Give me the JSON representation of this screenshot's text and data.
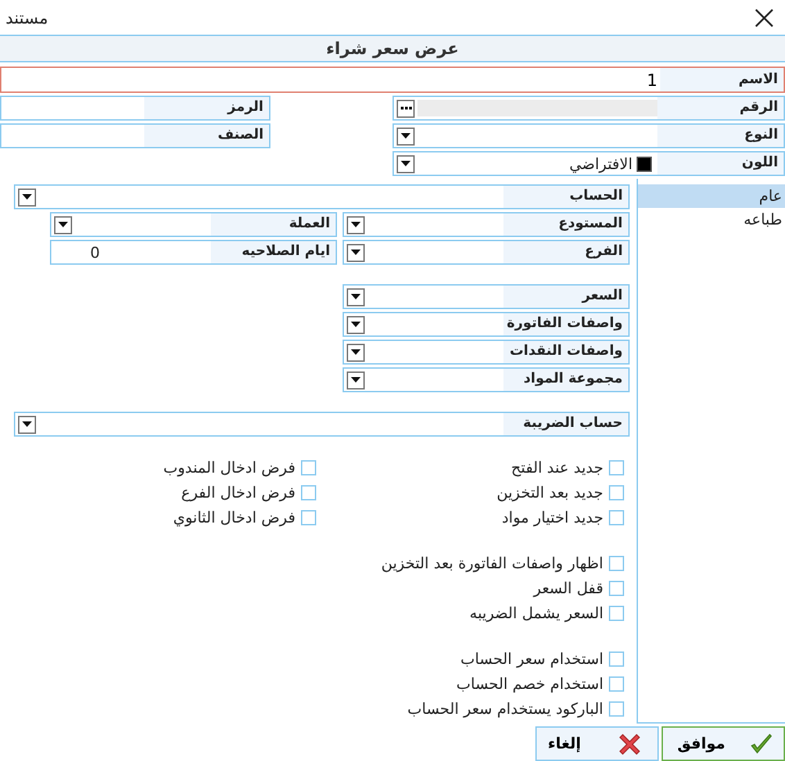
{
  "window": {
    "title": "مستند"
  },
  "header": "عرض سعر شراء",
  "name_field": {
    "label": "الاسم",
    "value": "1"
  },
  "top_right_fields": [
    {
      "label": "الرقم",
      "kind": "browse"
    },
    {
      "label": "النوع",
      "kind": "dropdown"
    },
    {
      "label": "اللون",
      "kind": "color",
      "color": "#000000",
      "value": "الافتراضي"
    }
  ],
  "top_left_fields": [
    {
      "label": "الرمز",
      "kind": "text"
    },
    {
      "label": "الصنف",
      "kind": "text"
    }
  ],
  "sidebar": {
    "items": [
      {
        "label": "عام",
        "selected": true
      },
      {
        "label": "طباعه",
        "selected": false
      }
    ]
  },
  "field_groups": [
    [
      {
        "kind": "wide",
        "fields": [
          {
            "label": "الحساب",
            "kind": "dropdown"
          }
        ]
      },
      {
        "kind": "pair",
        "fields": [
          {
            "label": "المستودع",
            "kind": "dropdown"
          },
          {
            "label": "العملة",
            "kind": "dropdown"
          }
        ]
      },
      {
        "kind": "pair",
        "fields": [
          {
            "label": "الفرع",
            "kind": "dropdown"
          },
          {
            "label": "ايام الصلاحيه",
            "kind": "text",
            "value": "0"
          }
        ]
      }
    ],
    [
      {
        "kind": "pair",
        "fields": [
          {
            "label": "السعر",
            "kind": "dropdown"
          }
        ]
      },
      {
        "kind": "pair",
        "fields": [
          {
            "label": "واصفات الفاتورة",
            "kind": "dropdown"
          }
        ]
      },
      {
        "kind": "pair",
        "fields": [
          {
            "label": "واصفات النقدات",
            "kind": "dropdown"
          }
        ]
      },
      {
        "kind": "pair",
        "fields": [
          {
            "label": "مجموعة المواد",
            "kind": "dropdown"
          }
        ]
      }
    ],
    [
      {
        "kind": "wide",
        "fields": [
          {
            "label": "حساب الضريبة",
            "kind": "dropdown"
          }
        ]
      }
    ]
  ],
  "checkbox_groups": [
    {
      "columns": [
        [
          {
            "label": "جديد عند الفتح",
            "checked": false
          },
          {
            "label": "جديد بعد التخزين",
            "checked": false
          },
          {
            "label": "جديد اختيار مواد",
            "checked": false
          }
        ],
        [
          {
            "label": "فرض ادخال المندوب",
            "checked": false
          },
          {
            "label": "فرض ادخال الفرع",
            "checked": false
          },
          {
            "label": "فرض ادخال الثانوي",
            "checked": false
          }
        ]
      ]
    },
    {
      "columns": [
        [
          {
            "label": "اظهار واصفات الفاتورة بعد التخزين",
            "checked": false
          },
          {
            "label": "قفل السعر",
            "checked": false
          },
          {
            "label": "السعر يشمل الضريبه",
            "checked": false
          }
        ]
      ]
    },
    {
      "columns": [
        [
          {
            "label": "استخدام سعر الحساب",
            "checked": false
          },
          {
            "label": "استخدام خصم الحساب",
            "checked": false
          },
          {
            "label": "الباركود يستخدام سعر الحساب",
            "checked": false
          }
        ]
      ]
    }
  ],
  "buttons": [
    {
      "label": "موافق",
      "kind": "ok"
    },
    {
      "label": "إلغاء",
      "kind": "cancel"
    }
  ]
}
